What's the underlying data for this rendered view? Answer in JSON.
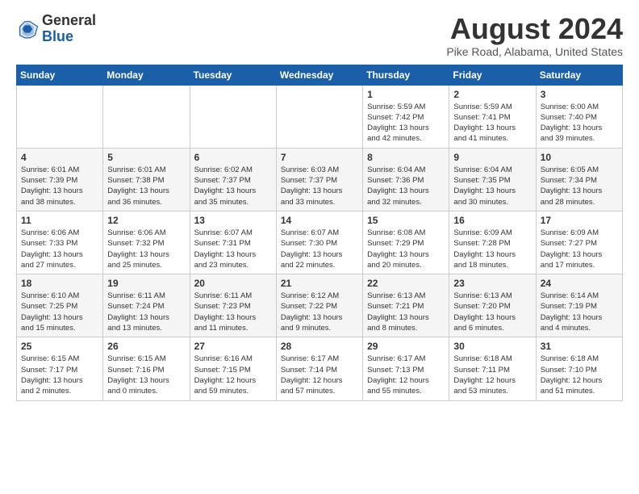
{
  "header": {
    "logo_general": "General",
    "logo_blue": "Blue",
    "month_title": "August 2024",
    "location": "Pike Road, Alabama, United States"
  },
  "weekdays": [
    "Sunday",
    "Monday",
    "Tuesday",
    "Wednesday",
    "Thursday",
    "Friday",
    "Saturday"
  ],
  "weeks": [
    [
      {
        "day": "",
        "info": ""
      },
      {
        "day": "",
        "info": ""
      },
      {
        "day": "",
        "info": ""
      },
      {
        "day": "",
        "info": ""
      },
      {
        "day": "1",
        "info": "Sunrise: 5:59 AM\nSunset: 7:42 PM\nDaylight: 13 hours\nand 42 minutes."
      },
      {
        "day": "2",
        "info": "Sunrise: 5:59 AM\nSunset: 7:41 PM\nDaylight: 13 hours\nand 41 minutes."
      },
      {
        "day": "3",
        "info": "Sunrise: 6:00 AM\nSunset: 7:40 PM\nDaylight: 13 hours\nand 39 minutes."
      }
    ],
    [
      {
        "day": "4",
        "info": "Sunrise: 6:01 AM\nSunset: 7:39 PM\nDaylight: 13 hours\nand 38 minutes."
      },
      {
        "day": "5",
        "info": "Sunrise: 6:01 AM\nSunset: 7:38 PM\nDaylight: 13 hours\nand 36 minutes."
      },
      {
        "day": "6",
        "info": "Sunrise: 6:02 AM\nSunset: 7:37 PM\nDaylight: 13 hours\nand 35 minutes."
      },
      {
        "day": "7",
        "info": "Sunrise: 6:03 AM\nSunset: 7:37 PM\nDaylight: 13 hours\nand 33 minutes."
      },
      {
        "day": "8",
        "info": "Sunrise: 6:04 AM\nSunset: 7:36 PM\nDaylight: 13 hours\nand 32 minutes."
      },
      {
        "day": "9",
        "info": "Sunrise: 6:04 AM\nSunset: 7:35 PM\nDaylight: 13 hours\nand 30 minutes."
      },
      {
        "day": "10",
        "info": "Sunrise: 6:05 AM\nSunset: 7:34 PM\nDaylight: 13 hours\nand 28 minutes."
      }
    ],
    [
      {
        "day": "11",
        "info": "Sunrise: 6:06 AM\nSunset: 7:33 PM\nDaylight: 13 hours\nand 27 minutes."
      },
      {
        "day": "12",
        "info": "Sunrise: 6:06 AM\nSunset: 7:32 PM\nDaylight: 13 hours\nand 25 minutes."
      },
      {
        "day": "13",
        "info": "Sunrise: 6:07 AM\nSunset: 7:31 PM\nDaylight: 13 hours\nand 23 minutes."
      },
      {
        "day": "14",
        "info": "Sunrise: 6:07 AM\nSunset: 7:30 PM\nDaylight: 13 hours\nand 22 minutes."
      },
      {
        "day": "15",
        "info": "Sunrise: 6:08 AM\nSunset: 7:29 PM\nDaylight: 13 hours\nand 20 minutes."
      },
      {
        "day": "16",
        "info": "Sunrise: 6:09 AM\nSunset: 7:28 PM\nDaylight: 13 hours\nand 18 minutes."
      },
      {
        "day": "17",
        "info": "Sunrise: 6:09 AM\nSunset: 7:27 PM\nDaylight: 13 hours\nand 17 minutes."
      }
    ],
    [
      {
        "day": "18",
        "info": "Sunrise: 6:10 AM\nSunset: 7:25 PM\nDaylight: 13 hours\nand 15 minutes."
      },
      {
        "day": "19",
        "info": "Sunrise: 6:11 AM\nSunset: 7:24 PM\nDaylight: 13 hours\nand 13 minutes."
      },
      {
        "day": "20",
        "info": "Sunrise: 6:11 AM\nSunset: 7:23 PM\nDaylight: 13 hours\nand 11 minutes."
      },
      {
        "day": "21",
        "info": "Sunrise: 6:12 AM\nSunset: 7:22 PM\nDaylight: 13 hours\nand 9 minutes."
      },
      {
        "day": "22",
        "info": "Sunrise: 6:13 AM\nSunset: 7:21 PM\nDaylight: 13 hours\nand 8 minutes."
      },
      {
        "day": "23",
        "info": "Sunrise: 6:13 AM\nSunset: 7:20 PM\nDaylight: 13 hours\nand 6 minutes."
      },
      {
        "day": "24",
        "info": "Sunrise: 6:14 AM\nSunset: 7:19 PM\nDaylight: 13 hours\nand 4 minutes."
      }
    ],
    [
      {
        "day": "25",
        "info": "Sunrise: 6:15 AM\nSunset: 7:17 PM\nDaylight: 13 hours\nand 2 minutes."
      },
      {
        "day": "26",
        "info": "Sunrise: 6:15 AM\nSunset: 7:16 PM\nDaylight: 13 hours\nand 0 minutes."
      },
      {
        "day": "27",
        "info": "Sunrise: 6:16 AM\nSunset: 7:15 PM\nDaylight: 12 hours\nand 59 minutes."
      },
      {
        "day": "28",
        "info": "Sunrise: 6:17 AM\nSunset: 7:14 PM\nDaylight: 12 hours\nand 57 minutes."
      },
      {
        "day": "29",
        "info": "Sunrise: 6:17 AM\nSunset: 7:13 PM\nDaylight: 12 hours\nand 55 minutes."
      },
      {
        "day": "30",
        "info": "Sunrise: 6:18 AM\nSunset: 7:11 PM\nDaylight: 12 hours\nand 53 minutes."
      },
      {
        "day": "31",
        "info": "Sunrise: 6:18 AM\nSunset: 7:10 PM\nDaylight: 12 hours\nand 51 minutes."
      }
    ]
  ]
}
